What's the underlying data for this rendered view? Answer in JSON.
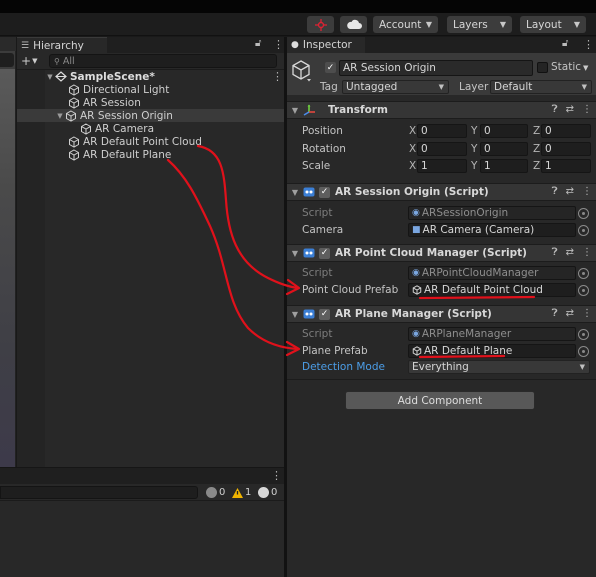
{
  "toolbar": {
    "account_label": "Account",
    "layers_label": "Layers",
    "layout_label": "Layout"
  },
  "hierarchy": {
    "tab_label": "Hierarchy",
    "search_placeholder": "All",
    "scene_name": "SampleScene*",
    "items": [
      {
        "label": "Directional Light"
      },
      {
        "label": "AR Session"
      },
      {
        "label": "AR Session Origin"
      },
      {
        "label": "AR Camera"
      },
      {
        "label": "AR Default Point Cloud"
      },
      {
        "label": "AR Default Plane"
      }
    ]
  },
  "console": {
    "info_count": "0",
    "warning_count": "1",
    "error_count": "0"
  },
  "inspector": {
    "tab_label": "Inspector",
    "object_name": "AR Session Origin",
    "static_label": "Static",
    "tag_label": "Tag",
    "tag_value": "Untagged",
    "layer_label": "Layer",
    "layer_value": "Default",
    "transform": {
      "title": "Transform",
      "position_label": "Position",
      "rotation_label": "Rotation",
      "scale_label": "Scale",
      "x_label": "X",
      "y_label": "Y",
      "z_label": "Z",
      "position": [
        "0",
        "0",
        "0"
      ],
      "rotation": [
        "0",
        "0",
        "0"
      ],
      "scale": [
        "1",
        "1",
        "1"
      ]
    },
    "session_origin": {
      "title": "AR Session Origin (Script)",
      "script_label": "Script",
      "script_value": "ARSessionOrigin",
      "camera_label": "Camera",
      "camera_value": "AR Camera (Camera)"
    },
    "point_cloud_manager": {
      "title": "AR Point Cloud Manager (Script)",
      "script_label": "Script",
      "script_value": "ARPointCloudManager",
      "prefab_label": "Point Cloud Prefab",
      "prefab_value": "AR Default Point Cloud"
    },
    "plane_manager": {
      "title": "AR Plane Manager (Script)",
      "script_label": "Script",
      "script_value": "ARPlaneManager",
      "prefab_label": "Plane Prefab",
      "prefab_value": "AR Default Plane",
      "detection_label": "Detection Mode",
      "detection_value": "Everything"
    },
    "add_component_label": "Add Component"
  },
  "annotation_color": "#e0111b",
  "accent_blue": "#4c9ee8"
}
